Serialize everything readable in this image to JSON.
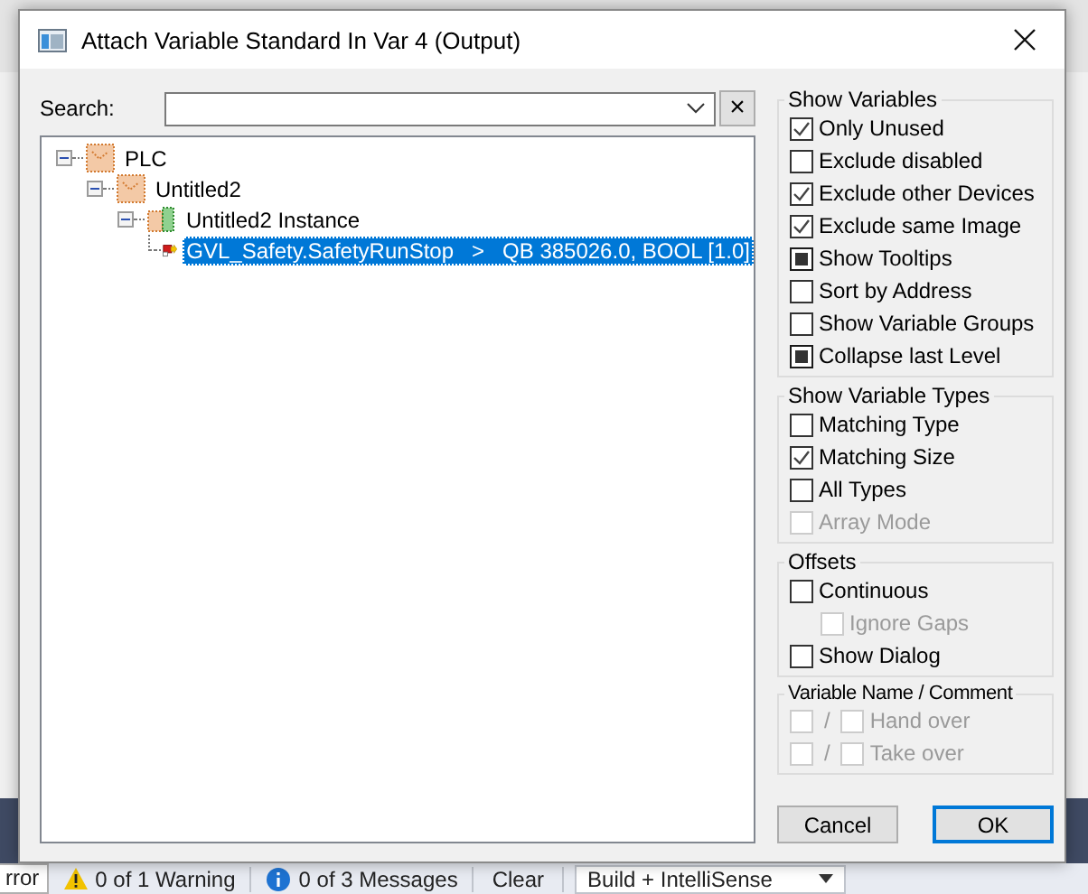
{
  "window": {
    "title": "Attach Variable Standard In Var 4 (Output)"
  },
  "search": {
    "label": "Search:",
    "clear_button": "×"
  },
  "tree": [
    {
      "label": "PLC",
      "kind": "plc",
      "expanded": true,
      "selected": false,
      "children": [
        {
          "label": "Untitled2",
          "kind": "project",
          "expanded": true,
          "selected": false,
          "children": [
            {
              "label": "Untitled2 Instance",
              "kind": "instance",
              "expanded": true,
              "selected": false,
              "children": [
                {
                  "label": "GVL_Safety.SafetyRunStop   >   QB 385026.0, BOOL [1.0]",
                  "kind": "variable",
                  "selected": true
                }
              ]
            }
          ]
        }
      ]
    }
  ],
  "groups": [
    {
      "title": "Show Variables",
      "items": [
        {
          "label": "Only Unused",
          "kind": "tick",
          "checked": true,
          "disabled": false
        },
        {
          "label": "Exclude disabled",
          "kind": "tick",
          "checked": false,
          "disabled": false
        },
        {
          "label": "Exclude other Devices",
          "kind": "tick",
          "checked": true,
          "disabled": false
        },
        {
          "label": "Exclude same Image",
          "kind": "tick",
          "checked": true,
          "disabled": false
        },
        {
          "label": "Show Tooltips",
          "kind": "square",
          "checked": true,
          "disabled": false
        },
        {
          "label": "Sort by Address",
          "kind": "tick",
          "checked": false,
          "disabled": false
        },
        {
          "label": "Show Variable Groups",
          "kind": "tick",
          "checked": false,
          "disabled": false
        },
        {
          "label": "Collapse last Level",
          "kind": "square",
          "checked": true,
          "disabled": false
        }
      ]
    },
    {
      "title": "Show Variable Types",
      "items": [
        {
          "label": "Matching Type",
          "checked": false,
          "disabled": false
        },
        {
          "label": "Matching Size",
          "checked": true,
          "disabled": false
        },
        {
          "label": "All Types",
          "checked": false,
          "disabled": false
        },
        {
          "label": "Array Mode",
          "checked": false,
          "disabled": true
        }
      ]
    },
    {
      "title": "Offsets",
      "items": [
        {
          "label": "Continuous",
          "checked": false,
          "disabled": false,
          "children": [
            {
              "label": "Ignore Gaps",
              "checked": false,
              "disabled": true
            }
          ]
        },
        {
          "label": "Show Dialog",
          "checked": false,
          "disabled": false
        }
      ]
    }
  ],
  "name_comment": {
    "title": "Variable Name / Comment",
    "rows": [
      {
        "name_checked": false,
        "separator": "/",
        "comment_checked": false,
        "label": "Hand over",
        "disabled": true
      },
      {
        "name_checked": false,
        "separator": "/",
        "comment_checked": false,
        "label": "Take over",
        "disabled": true
      }
    ]
  },
  "buttons": [
    {
      "label": "Cancel",
      "default": false
    },
    {
      "label": "OK",
      "default": true
    }
  ],
  "status_bar": {
    "errors": "rror",
    "warnings": "0 of 1 Warning",
    "messages": "0 of 3 Messages",
    "clear": "Clear",
    "build": "Build + IntelliSense"
  }
}
